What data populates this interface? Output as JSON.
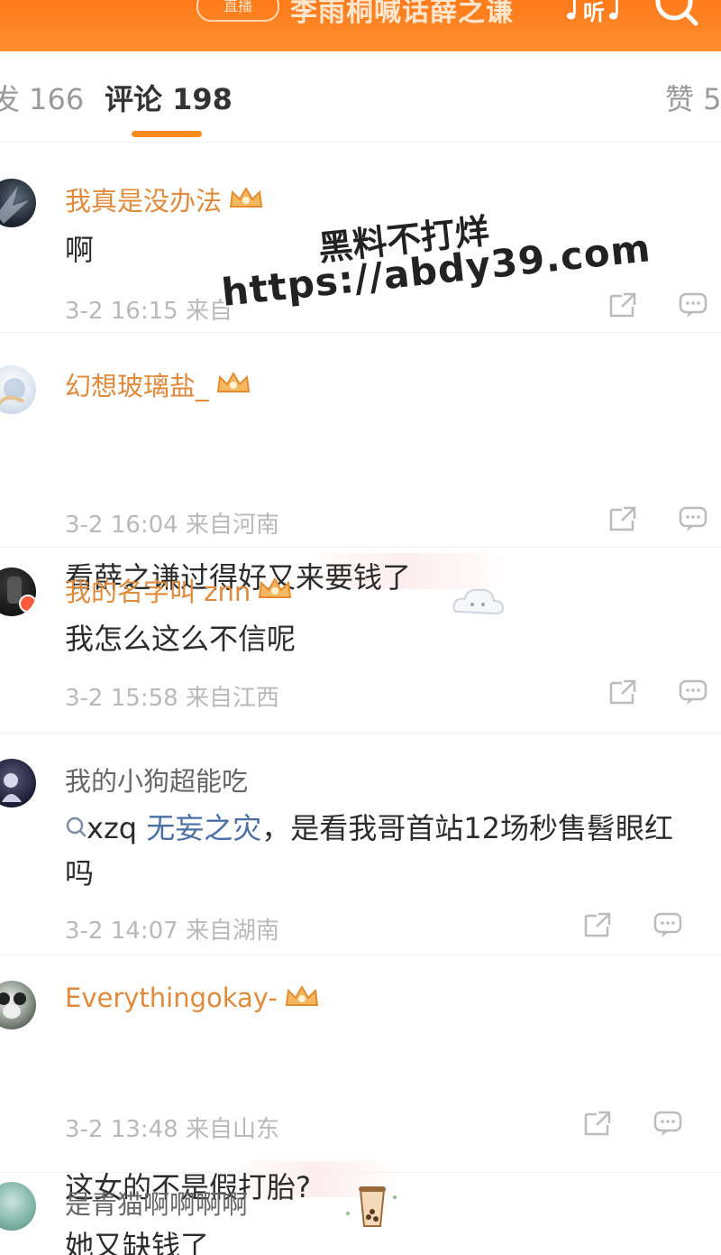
{
  "header": {
    "live_label": "直播",
    "title": "李雨桐喊话薛之谦",
    "listen_label": "听",
    "colors": {
      "bar": "#ff7a1a",
      "bar_text": "#ffe7cf"
    }
  },
  "tabs": {
    "repost": "发 166",
    "comment": "评论 198",
    "like": "赞 5",
    "active": "comment",
    "accent": "#ff8a1f"
  },
  "comments": [
    {
      "name": "我真是没办法",
      "vip": true,
      "text": "啊",
      "time": "3-2 16:15",
      "location": "来自"
    },
    {
      "name": "幻想玻璃盐_",
      "vip": true,
      "text": "看薛之谦过得好又来要钱了",
      "time": "3-2 16:04",
      "location": "来自河南"
    },
    {
      "name": "我的名字叫 znn",
      "vip": true,
      "text": "我怎么这么不信呢",
      "time": "3-2 15:58",
      "location": "来自江西"
    },
    {
      "name": "我的小狗超能吃",
      "vip": false,
      "mention": "xzq",
      "tag": "无妄之灾",
      "text": "，是看我哥首站12场秒售髫眼红",
      "text_cont": "吗",
      "time": "3-2 14:07",
      "location": "来自湖南"
    },
    {
      "name": "Everythingokay-",
      "vip": true,
      "text": "这女的不是假打胎?",
      "time": "3-2 13:48",
      "location": "来自山东"
    },
    {
      "name": "是青猫啊啊啊啊",
      "vip": false,
      "text": "她又缺钱了"
    }
  ],
  "watermark": {
    "line1": "黑料不打烊",
    "line2": "https://abdy39.com"
  },
  "icons": {
    "crown": "crown-icon",
    "share": "share-icon",
    "reply": "reply-icon",
    "search": "search-icon",
    "music": "music-note-icon"
  }
}
